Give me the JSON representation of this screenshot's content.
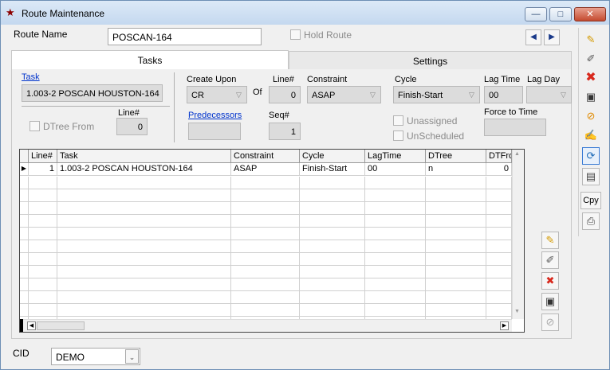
{
  "window": {
    "title": "Route Maintenance",
    "min_glyph": "—",
    "max_glyph": "□",
    "close_glyph": "✕"
  },
  "header": {
    "route_name_label": "Route Name",
    "route_name_value": "POSCAN-164",
    "hold_route_label": "Hold Route",
    "prev_glyph": "◀",
    "next_glyph": "▶"
  },
  "tabs": [
    {
      "label": "Tasks"
    },
    {
      "label": "Settings"
    }
  ],
  "task": {
    "task_label": "Task",
    "task_value": "1.003-2 POSCAN HOUSTON-164",
    "line_label": "Line#",
    "line_value": "0",
    "dtree_from_label": "DTree From",
    "create_upon_label": "Create Upon",
    "create_upon_value": "CR",
    "of_label": "Of",
    "line2_label": "Line#",
    "line2_value": "0",
    "constraint_label": "Constraint",
    "constraint_value": "ASAP",
    "cycle_label": "Cycle",
    "cycle_value": "Finish-Start",
    "lag_time_label": "Lag Time",
    "lag_time_value": "00",
    "lag_day_label": "Lag Day",
    "lag_day_value": "",
    "predecessors_label": "Predecessors",
    "seq_label": "Seq#",
    "seq_value": "1",
    "unassigned_label": "Unassigned",
    "unscheduled_label": "UnScheduled",
    "force_to_time_label": "Force to Time"
  },
  "grid": {
    "columns": [
      "Line#",
      "Task",
      "Constraint",
      "Cycle",
      "LagTime",
      "DTree",
      "DTFrom"
    ],
    "rows": [
      [
        "1",
        "1.003-2 POSCAN HOUSTON-164",
        "ASAP",
        "Finish-Start",
        "00",
        "n",
        "0"
      ]
    ]
  },
  "grid_side_buttons": [
    {
      "icon": "new-icon",
      "glyph": "✎"
    },
    {
      "icon": "edit-icon",
      "glyph": "✐"
    },
    {
      "icon": "delete-icon",
      "glyph": "✖"
    },
    {
      "icon": "save-icon",
      "glyph": "▣"
    },
    {
      "icon": "cancel-icon",
      "glyph": "⊘"
    }
  ],
  "toolbar": [
    {
      "icon": "new-icon",
      "glyph": "✎"
    },
    {
      "icon": "edit-icon",
      "glyph": "✐"
    },
    {
      "icon": "delete-icon",
      "glyph": "✖"
    },
    {
      "icon": "save-icon",
      "glyph": "▣"
    },
    {
      "icon": "cancel-icon",
      "glyph": "⊘"
    },
    {
      "icon": "notes-icon",
      "glyph": "✍"
    },
    {
      "icon": "refresh-icon",
      "glyph": "⟳"
    },
    {
      "icon": "report-icon",
      "glyph": "▤"
    },
    {
      "icon": "copy-icon",
      "glyph": "Cpy"
    },
    {
      "icon": "print-icon",
      "glyph": "⎙"
    }
  ],
  "footer": {
    "cid_label": "CID",
    "cid_value": "DEMO"
  },
  "colors": {
    "link": "#0033cc",
    "delete": "#d8281c",
    "title_bg": "#dce9f7"
  }
}
